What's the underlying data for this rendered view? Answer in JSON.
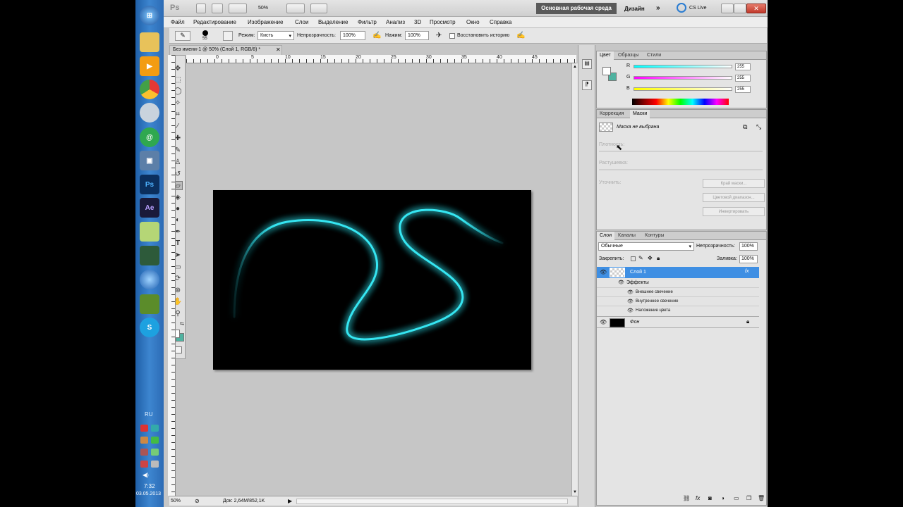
{
  "taskbar": {
    "lang": "RU",
    "time": "7:32",
    "date": "03.05.2013",
    "icons": [
      "windows-start-icon",
      "folder-icon",
      "media-player-icon",
      "chrome-icon",
      "disc-icon",
      "mail-agent-icon",
      "virtualbox-icon",
      "photoshop-icon",
      "after-effects-icon",
      "notepad-icon",
      "kit-icon",
      "globe-icon",
      "minecraft-icon",
      "skype-icon"
    ],
    "ps_label": "Ps",
    "ae_label": "Ae",
    "skype_label": "S"
  },
  "appbar": {
    "logo": "Ps",
    "zoom": "50%",
    "workspace": "Основная рабочая среда",
    "design": "Дизайн",
    "more": "»",
    "cslive": "CS Live"
  },
  "menu": [
    "Файл",
    "Редактирование",
    "Изображение",
    "Слои",
    "Выделение",
    "Фильтр",
    "Анализ",
    "3D",
    "Просмотр",
    "Окно",
    "Справка"
  ],
  "options": {
    "brush_size": "55",
    "mode_label": "Режим:",
    "mode_value": "Кисть",
    "opacity_label": "Непрозрачность:",
    "opacity_value": "100%",
    "pressure_label": "Нажим:",
    "pressure_value": "100%",
    "restore_label": "Восстановить историю"
  },
  "document": {
    "tab_title": "Без имени-1 @ 50% (Слой 1, RGB/8) *",
    "ruler_numbers": [
      "0",
      "5",
      "10",
      "15",
      "20",
      "25",
      "30",
      "35",
      "40",
      "45"
    ],
    "zoom": "50%",
    "doc_info": "Док: 2,64M/852,1K"
  },
  "colors": {
    "glow": "#35e6f2",
    "layer_selected": "#3f8fe3",
    "workspace_btn": "#5a5a5a"
  },
  "color_panel": {
    "tabs": [
      "Цвет",
      "Образцы",
      "Стили"
    ],
    "channels": [
      {
        "label": "R",
        "value": "255"
      },
      {
        "label": "G",
        "value": "255"
      },
      {
        "label": "B",
        "value": "255"
      }
    ]
  },
  "masks_panel": {
    "tabs": [
      "Коррекция",
      "Маски"
    ],
    "no_mask": "Маска не выбрана",
    "density": "Плотность:",
    "feather": "Растушевка:",
    "refine": "Уточнить:",
    "buttons": [
      "Край маски...",
      "Цветовой диапазон...",
      "Инвертировать"
    ]
  },
  "layers_panel": {
    "tabs": [
      "Слои",
      "Каналы",
      "Контуры"
    ],
    "blend_mode": "Обычные",
    "opacity_label": "Непрозрачность:",
    "opacity_value": "100%",
    "lock_label": "Закрепить:",
    "fill_label": "Заливка:",
    "fill_value": "100%",
    "layer1": "Слой 1",
    "fx": "fx",
    "effects": "Эффекты",
    "effect_items": [
      "Внешнее свечение",
      "Внутреннее свечение",
      "Наложение цвета"
    ],
    "background": "Фон"
  }
}
